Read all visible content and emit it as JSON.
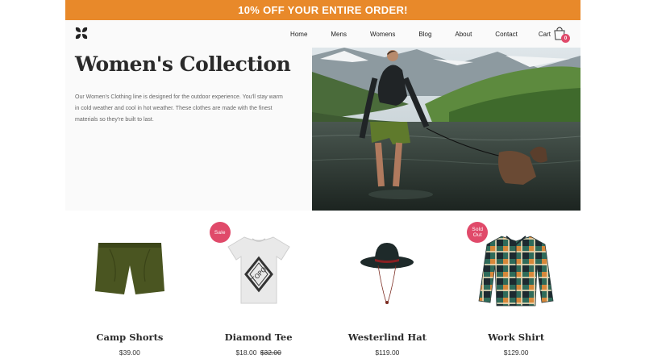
{
  "promo": {
    "text": "10% OFF YOUR ENTIRE ORDER!"
  },
  "header": {
    "logo_icon": "four-petal-logo-icon",
    "nav": [
      "Home",
      "Mens",
      "Womens",
      "Blog",
      "About",
      "Contact"
    ],
    "cart_label": "Cart",
    "cart_icon": "shopping-bag-icon",
    "cart_count": "0"
  },
  "hero": {
    "title": "Women's Collection",
    "description": "Our Women's Clothing line is designed for the outdoor experience. You'll stay warm in cold weather and cool in hot weather. These clothes are made with the finest materials so they're built to last."
  },
  "products": [
    {
      "name": "Camp Shorts",
      "price": "$39.00",
      "old_price": "",
      "badge": ""
    },
    {
      "name": "Diamond Tee",
      "price": "$18.00",
      "old_price": "$32.00",
      "badge": "Sale"
    },
    {
      "name": "Westerlind Hat",
      "price": "$119.00",
      "old_price": "",
      "badge": ""
    },
    {
      "name": "Work Shirt",
      "price": "$129.00",
      "old_price": "",
      "badge": "Sold Out"
    }
  ],
  "colors": {
    "promo": "#e8892a",
    "badge": "#e04a6a"
  }
}
